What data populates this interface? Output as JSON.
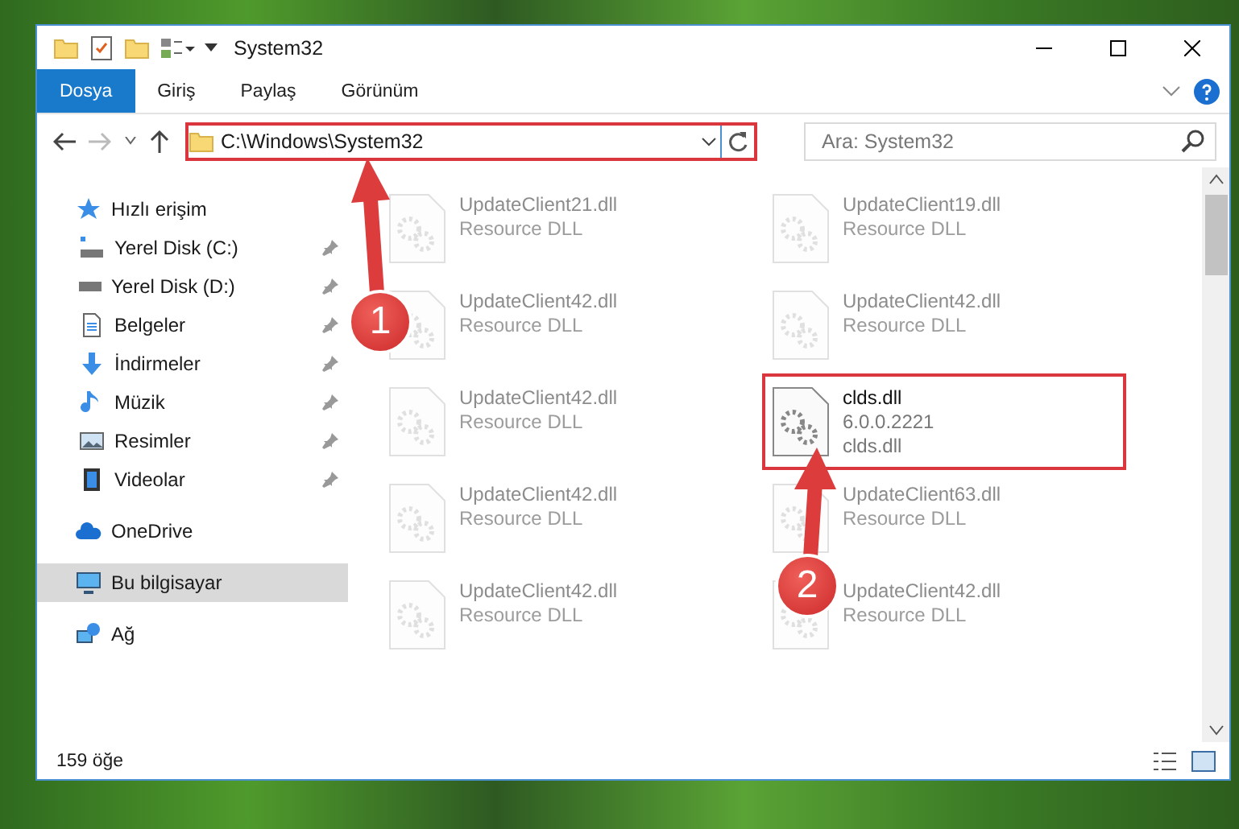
{
  "window": {
    "title": "System32"
  },
  "ribbon_tabs": [
    {
      "label": "Dosya",
      "selected": true
    },
    {
      "label": "Giriş",
      "selected": false
    },
    {
      "label": "Paylaş",
      "selected": false
    },
    {
      "label": "Görünüm",
      "selected": false
    }
  ],
  "address": {
    "value": "C:\\Windows\\System32",
    "highlighted": true
  },
  "search": {
    "placeholder": "Ara: System32"
  },
  "sidebar": {
    "items": [
      {
        "kind": "star",
        "label": "Hızlı erişim",
        "pinned": false,
        "selected": false,
        "children": [
          {
            "kind": "windrive",
            "label": "Yerel Disk (C:)",
            "pinned": true,
            "selected": false
          },
          {
            "kind": "drive",
            "label": "Yerel Disk (D:)",
            "pinned": true,
            "selected": false
          },
          {
            "kind": "document",
            "label": "Belgeler",
            "pinned": true,
            "selected": false
          },
          {
            "kind": "download",
            "label": "İndirmeler",
            "pinned": true,
            "selected": false
          },
          {
            "kind": "music",
            "label": "Müzik",
            "pinned": true,
            "selected": false
          },
          {
            "kind": "pictures",
            "label": "Resimler",
            "pinned": true,
            "selected": false
          },
          {
            "kind": "video",
            "label": "Videolar",
            "pinned": true,
            "selected": false
          }
        ]
      },
      {
        "kind": "cloud",
        "label": "OneDrive",
        "pinned": false,
        "selected": false
      },
      {
        "kind": "computer",
        "label": "Bu bilgisayar",
        "pinned": false,
        "selected": true
      },
      {
        "kind": "network",
        "label": "Ağ",
        "pinned": false,
        "selected": false
      }
    ]
  },
  "files": [
    {
      "lines": [
        "UpdateClient21.dll",
        "Resource DLL"
      ],
      "faded": true,
      "highlighted": false
    },
    {
      "lines": [
        "UpdateClient19.dll",
        "Resource DLL"
      ],
      "faded": true,
      "highlighted": false
    },
    {
      "lines": [
        "UpdateClient42.dll",
        "Resource DLL"
      ],
      "faded": true,
      "highlighted": false
    },
    {
      "lines": [
        "UpdateClient42.dll",
        "Resource DLL"
      ],
      "faded": true,
      "highlighted": false
    },
    {
      "lines": [
        "UpdateClient42.dll",
        "Resource DLL"
      ],
      "faded": true,
      "highlighted": false
    },
    {
      "lines": [
        "clds.dll",
        "6.0.0.2221",
        "clds.dll"
      ],
      "faded": false,
      "highlighted": true
    },
    {
      "lines": [
        "UpdateClient42.dll",
        "Resource DLL"
      ],
      "faded": true,
      "highlighted": false
    },
    {
      "lines": [
        "UpdateClient63.dll",
        "Resource DLL"
      ],
      "faded": true,
      "highlighted": false
    },
    {
      "lines": [
        "UpdateClient42.dll",
        "Resource DLL"
      ],
      "faded": true,
      "highlighted": false
    },
    {
      "lines": [
        "UpdateClient42.dll",
        "Resource DLL"
      ],
      "faded": true,
      "highlighted": false
    }
  ],
  "status_bar": {
    "count": "159 öğe"
  },
  "annotations": [
    {
      "number": "1"
    },
    {
      "number": "2"
    }
  ]
}
